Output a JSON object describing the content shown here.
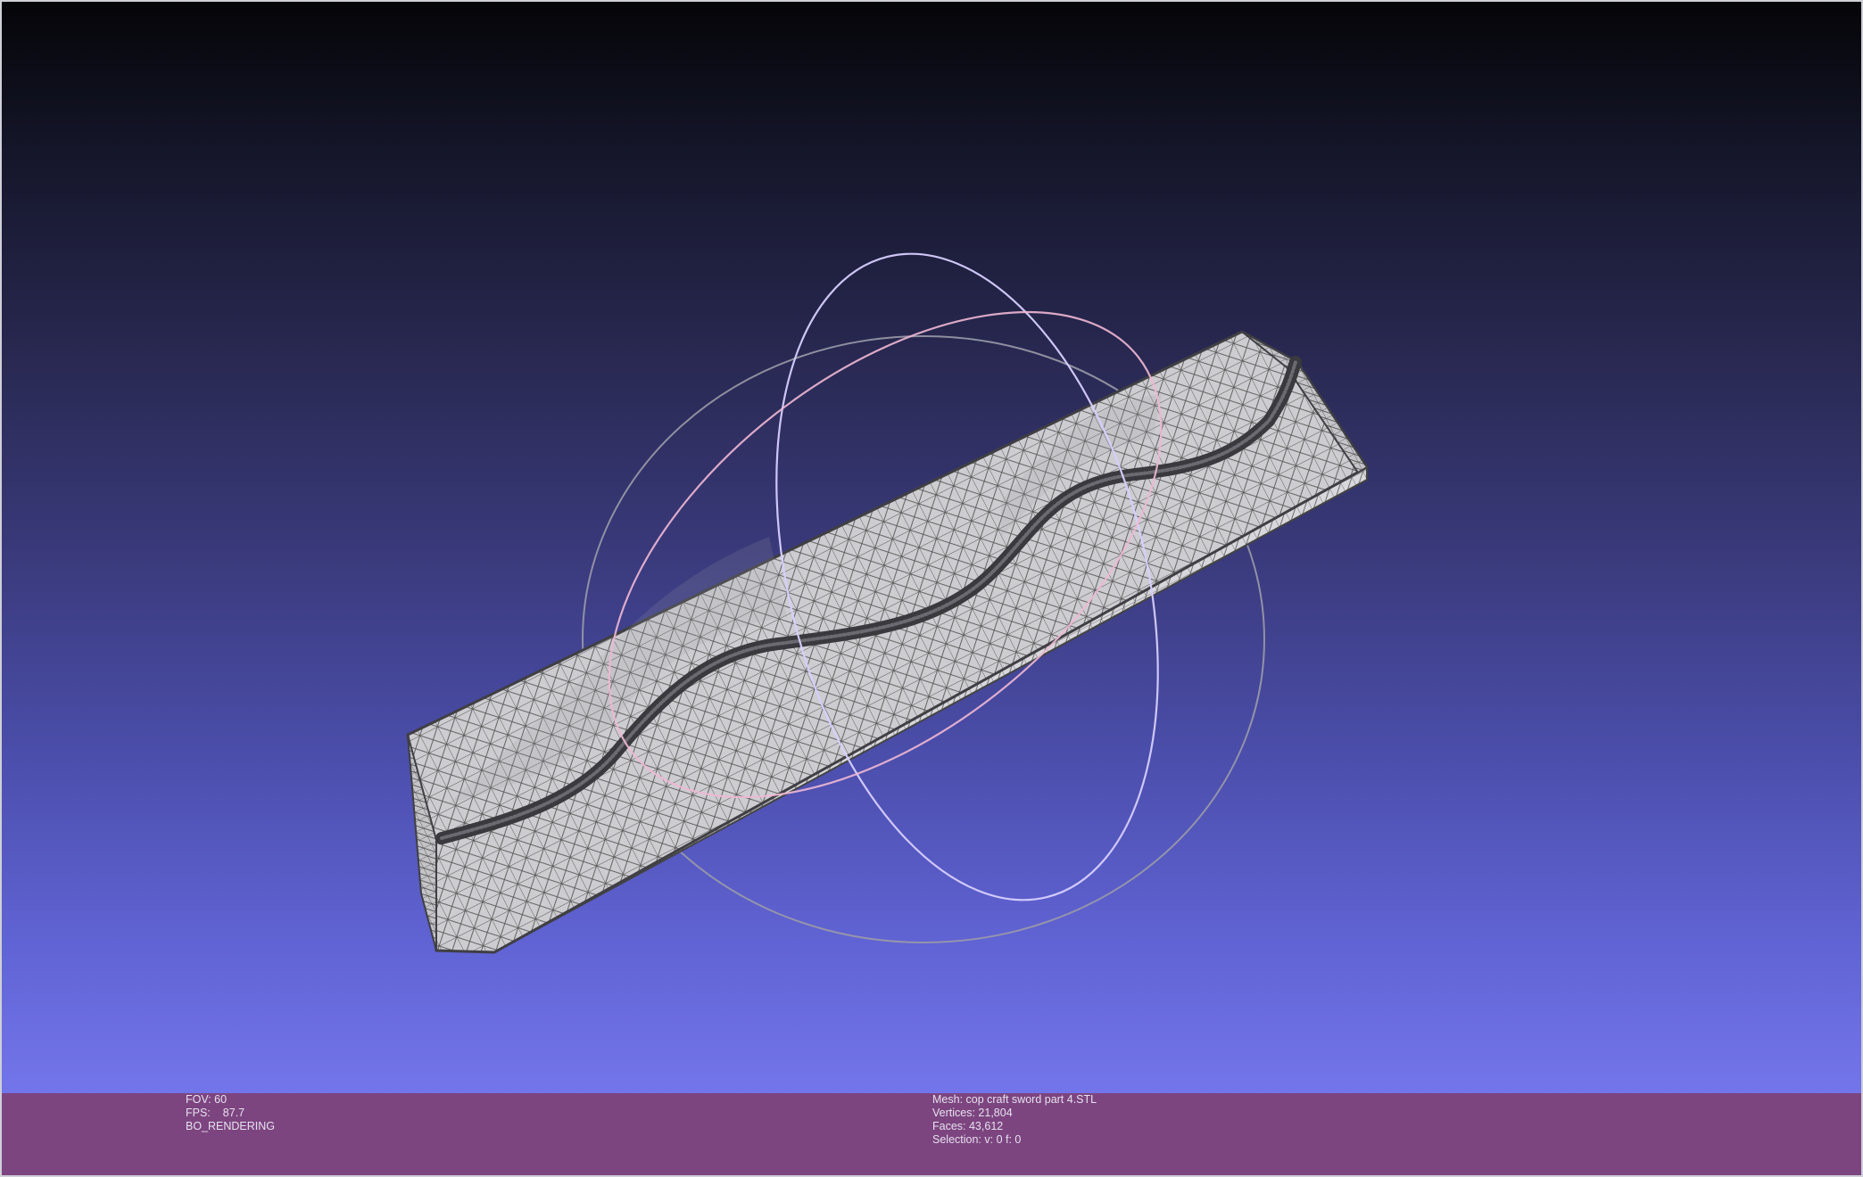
{
  "viewer": {
    "trackball": {
      "ring_colors": [
        "#a6a6b0",
        "#d7cfff",
        "#f0b8d4"
      ]
    },
    "mesh_colors": {
      "surface": "#cfcfd4",
      "wire": "#4a4a4a",
      "dark_edge": "#555558"
    }
  },
  "status_left": {
    "fov": "FOV: 60",
    "fps_label": "FPS:",
    "fps_value": "87.7",
    "render_mode": "BO_RENDERING"
  },
  "status_right": {
    "mesh": "Mesh: cop craft sword part 4.STL",
    "vertices": "Vertices: 21,804",
    "faces": "Faces: 43,612",
    "selection": "Selection: v: 0 f: 0"
  }
}
